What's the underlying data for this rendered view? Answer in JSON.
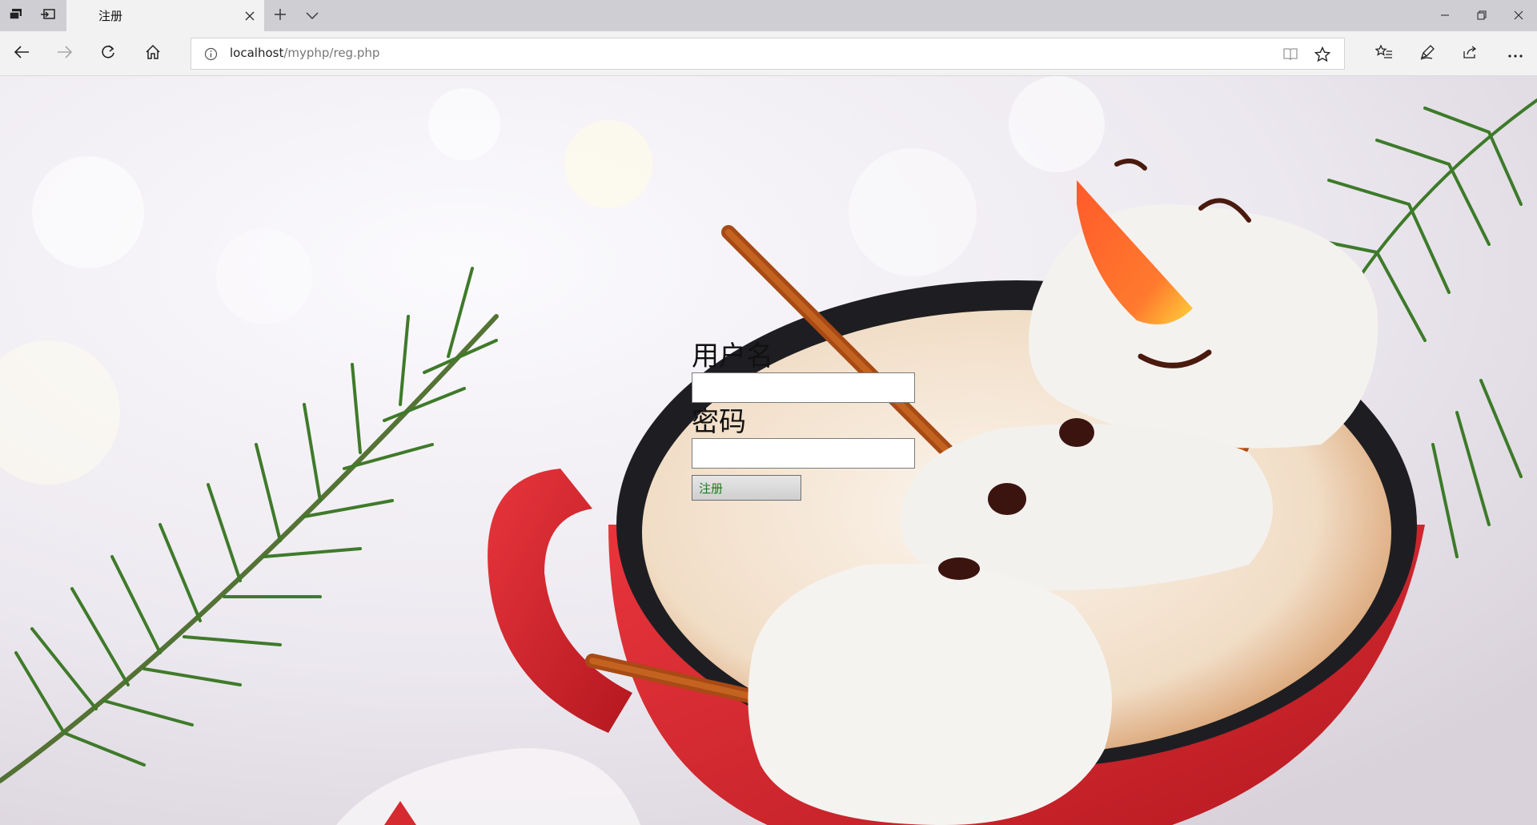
{
  "browser": {
    "tab": {
      "title": "注册"
    },
    "address_bar": {
      "host": "localhost",
      "path": "/myphp/reg.php"
    }
  },
  "icons": {
    "tab_bar": [
      "tab-preview-icon",
      "set-aside-tabs-icon",
      "close-icon",
      "plus-icon",
      "chevron-down-icon"
    ],
    "window": [
      "minimize-icon",
      "restore-icon",
      "close-icon"
    ],
    "toolbar": [
      "back-arrow-icon",
      "forward-arrow-icon",
      "refresh-icon",
      "home-icon",
      "info-icon",
      "reading-view-icon",
      "star-icon",
      "favorites-hub-icon",
      "pen-icon",
      "share-icon",
      "more-icon"
    ]
  },
  "form": {
    "username_label": "用户名",
    "password_label": "密码",
    "submit_label": "注册"
  },
  "colors": {
    "chrome_background": "#f2f2f2",
    "tab_strip": "#cfcfd3",
    "submit_text": "#1a7a1a"
  }
}
